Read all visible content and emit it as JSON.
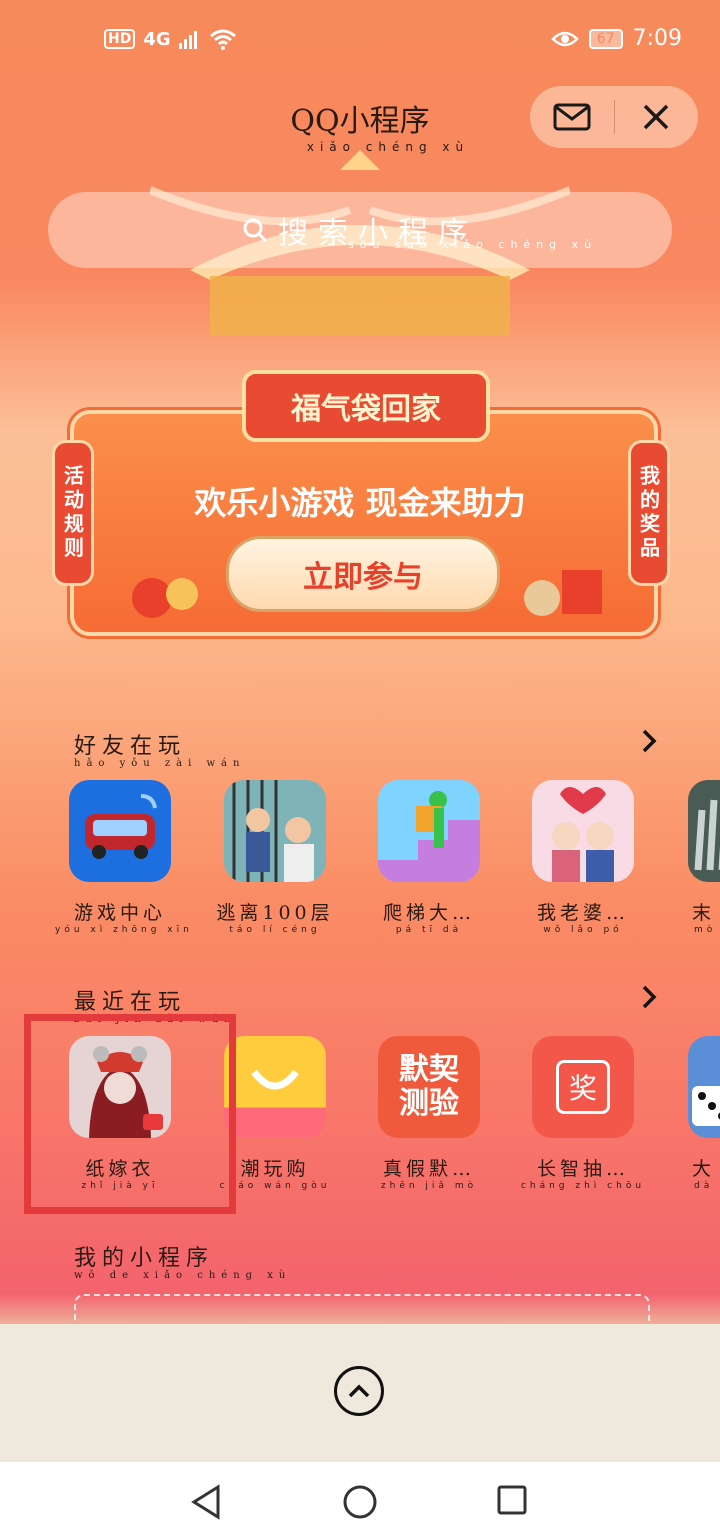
{
  "status_bar": {
    "hd": "HD",
    "network": "4G",
    "battery": "67",
    "time": "7:09"
  },
  "header": {
    "title": "QQ小程序",
    "title_pinyin": "xiǎo chéng xù"
  },
  "search": {
    "placeholder": "搜索小程序",
    "placeholder_pinyin": "sōu suǒ xiǎo chéng xù"
  },
  "banner": {
    "tag": "福气袋回家",
    "slogan": "欢乐小游戏 现金来助力",
    "button": "立即参与",
    "left_scroll": "活动规则",
    "right_scroll": "我的奖品"
  },
  "friends_playing": {
    "title": "好友在玩",
    "title_pinyin": "hǎo yǒu zài wán",
    "apps": [
      {
        "name": "游戏中心",
        "pinyin": "yóu xì zhōng xīn",
        "icon": "game-center-icon"
      },
      {
        "name": "逃离100层",
        "pinyin": "táo lí céng",
        "icon": "escape-100-icon"
      },
      {
        "name": "爬梯大…",
        "pinyin": "pá tī dà",
        "icon": "climb-stairs-icon"
      },
      {
        "name": "我老婆…",
        "pinyin": "wǒ lǎo pó",
        "icon": "my-wife-icon"
      },
      {
        "name": "末",
        "pinyin": "mò",
        "icon": "horror-hand-icon"
      }
    ]
  },
  "recent_playing": {
    "title": "最近在玩",
    "title_pinyin": "zuì jìn zài wán",
    "apps": [
      {
        "name": "纸嫁衣",
        "pinyin": "zhǐ jià yī",
        "icon": "paper-bride-icon"
      },
      {
        "name": "潮玩购",
        "pinyin": "cháo wán gòu",
        "icon": "shopping-bag-icon"
      },
      {
        "name": "真假默…",
        "pinyin": "zhēn jiǎ mò",
        "icon": "mo-qi-icon",
        "icon_text": "默契测验"
      },
      {
        "name": "长智抽…",
        "pinyin": "cháng zhì chōu",
        "icon": "prize-icon",
        "icon_text": "奖"
      },
      {
        "name": "大",
        "pinyin": "dà",
        "icon": "dice-icon"
      }
    ]
  },
  "my_mini_programs": {
    "title": "我的小程序",
    "title_pinyin": "wǒ de xiǎo chéng xù"
  },
  "colors": {
    "accent_red": "#e33b3b",
    "banner_orange": "#f66b35",
    "text_dark": "#2a1a14"
  }
}
